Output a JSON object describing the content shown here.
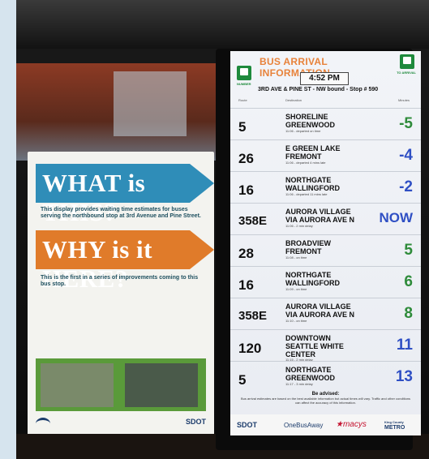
{
  "poster": {
    "heading1": "WHAT is THIS?",
    "text1": "This display provides waiting time estimates for buses serving the northbound stop at 3rd Avenue and Pine Street.",
    "heading2": "WHY is it HERE?",
    "text2": "This is the first in a series of improvements coming to this bus stop.",
    "logo": "SDOT",
    "colors": {
      "blue": "#2f8db8",
      "orange": "#e07b2a",
      "green": "#5a9a3a"
    }
  },
  "sign": {
    "title": "BUS ARRIVAL INFORMATION",
    "time": "4:52 PM",
    "stop": "3RD AVE & PINE ST - NW bound - Stop # 590",
    "left_icon_label": "NUMBER",
    "right_icon_label": "TO ARRIVAL",
    "col_route": "Route",
    "col_dest": "Destination",
    "col_minutes": "Minutes",
    "arrivals": [
      {
        "route": "5",
        "dest1": "SHORELINE",
        "dest2": "GREENWOOD",
        "dest3": "",
        "status": "11:06 - departed on time",
        "eta": "-5",
        "eta_color": "#2e8b3a"
      },
      {
        "route": "26",
        "dest1": "E GREEN LAKE",
        "dest2": "FREMONT",
        "dest3": "",
        "status": "11:06 - departed 4 mins late",
        "eta": "-4",
        "eta_color": "#2f4fc4"
      },
      {
        "route": "16",
        "dest1": "NORTHGATE",
        "dest2": "WALLINGFORD",
        "dest3": "",
        "status": "11:06 - departed 11 mins late",
        "eta": "-2",
        "eta_color": "#2f4fc4"
      },
      {
        "route": "358E",
        "dest1": "AURORA VILLAGE",
        "dest2": "VIA AURORA AVE N",
        "dest3": "",
        "status": "11:06 - 2 min delay",
        "eta": "NOW",
        "eta_color": "#2f4fc4"
      },
      {
        "route": "28",
        "dest1": "BROADVIEW",
        "dest2": "FREMONT",
        "dest3": "",
        "status": "11:08 - on time",
        "eta": "5",
        "eta_color": "#2e8b3a"
      },
      {
        "route": "16",
        "dest1": "NORTHGATE",
        "dest2": "WALLINGFORD",
        "dest3": "",
        "status": "11:09 - on time",
        "eta": "6",
        "eta_color": "#2e8b3a"
      },
      {
        "route": "358E",
        "dest1": "AURORA VILLAGE",
        "dest2": "VIA AURORA AVE N",
        "dest3": "",
        "status": "11:10 - on time",
        "eta": "8",
        "eta_color": "#2e8b3a"
      },
      {
        "route": "120",
        "dest1": "DOWNTOWN",
        "dest2": "SEATTLE WHITE",
        "dest3": "CENTER",
        "status": "11:15 - 2 min delay",
        "eta": "11",
        "eta_color": "#2f4fc4"
      },
      {
        "route": "5",
        "dest1": "NORTHGATE",
        "dest2": "GREENWOOD",
        "dest3": "",
        "status": "11:17 - 3 min delay",
        "eta": "13",
        "eta_color": "#2f4fc4"
      }
    ],
    "advise_title": "Be advised:",
    "advise_text": "Bus arrival estimates are based on the best available information but actual times will vary. Traffic and other conditions can affect the accuracy of this information.",
    "footer": {
      "sdot": "SDOT",
      "onebusaway": "OneBusAway",
      "macys": "★macys",
      "metro1": "King County",
      "metro2": "METRO"
    }
  }
}
